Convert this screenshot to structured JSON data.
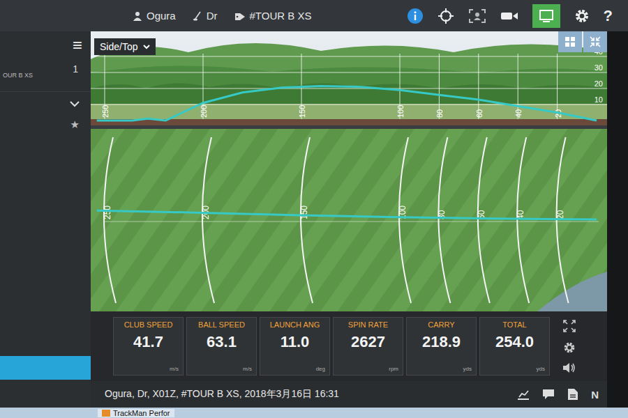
{
  "header": {
    "user": "Ogura",
    "club": "Dr",
    "ball": "#TOUR B XS",
    "help_glyph": "?",
    "layout_toggle": {
      "selected": true
    }
  },
  "sidebar": {
    "menu_glyph": "≡",
    "shot_label": "OUR B XS",
    "shot_number": "1",
    "star_glyph": "★",
    "favorite": false
  },
  "view_selector": {
    "label": "Side/Top"
  },
  "side_view": {
    "distance_ticks": [
      "250",
      "200",
      "150",
      "100",
      "80",
      "60",
      "40",
      "20"
    ],
    "height_ticks": [
      "40",
      "30",
      "20",
      "10"
    ],
    "distances": [
      0,
      20,
      40,
      60,
      80,
      100,
      120,
      140,
      160,
      180,
      200,
      219,
      228,
      236,
      254
    ],
    "heights": [
      0,
      5,
      9,
      13,
      16,
      19,
      21,
      21.5,
      20.5,
      17.5,
      11,
      0,
      1.2,
      0,
      0
    ]
  },
  "top_view": {
    "distance_ticks": [
      "250",
      "200",
      "150",
      "100",
      "80",
      "60",
      "40",
      "20"
    ],
    "distances": [
      0,
      50,
      100,
      150,
      200,
      254
    ],
    "lateral": [
      0,
      0.3,
      0.8,
      1.5,
      2.4,
      3.2
    ]
  },
  "metrics": [
    {
      "label": "CLUB SPEED",
      "value": "41.7",
      "unit": "m/s"
    },
    {
      "label": "BALL SPEED",
      "value": "63.1",
      "unit": "m/s"
    },
    {
      "label": "LAUNCH ANG",
      "value": "11.0",
      "unit": "deg"
    },
    {
      "label": "SPIN RATE",
      "value": "2627",
      "unit": "rpm"
    },
    {
      "label": "CARRY",
      "value": "218.9",
      "unit": "yds"
    },
    {
      "label": "TOTAL",
      "value": "254.0",
      "unit": "yds"
    }
  ],
  "status_line": "Ogura, Dr, X01Z, #TOUR B XS, 2018年3月16日 16:31",
  "status_glyph": "N",
  "taskbar": {
    "app_label": "TrackMan Perfor"
  }
}
